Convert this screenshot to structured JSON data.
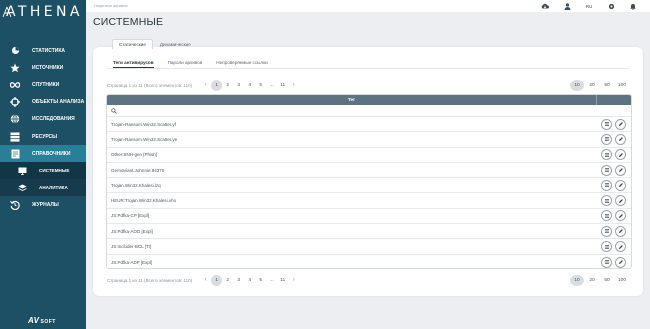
{
  "app": {
    "logo": "ATHENA",
    "brand": "SOFT"
  },
  "topbar": {
    "license": "Лицензия активна",
    "lang": "RU"
  },
  "sidebar": {
    "items": [
      {
        "label": "СТАТИСТИКА",
        "icon": "pie-chart-icon"
      },
      {
        "label": "ИСТОЧНИКИ",
        "icon": "star-icon"
      },
      {
        "label": "СПУТНИКИ",
        "icon": "infinity-icon"
      },
      {
        "label": "ОБЪЕКТЫ АНАЛИЗА",
        "icon": "crosshair-icon"
      },
      {
        "label": "ИССЛЕДОВАНИЯ",
        "icon": "globe-icon"
      },
      {
        "label": "РЕСУРСЫ",
        "icon": "database-icon"
      },
      {
        "label": "СПРАВОЧНИКИ",
        "icon": "book-icon"
      }
    ],
    "sub_items": [
      {
        "label": "СИСТЕМНЫЕ",
        "icon": "monitor-icon"
      },
      {
        "label": "АНАЛИТИКА",
        "icon": "layers-icon"
      }
    ],
    "last_item": {
      "label": "ЖУРНАЛЫ",
      "icon": "history-icon"
    }
  },
  "page": {
    "title": "СИСТЕМНЫЕ"
  },
  "outer_tabs": [
    "Статические",
    "Динамические"
  ],
  "inner_tabs": [
    "Теги антивирусов",
    "Пароли архивов",
    "Непроверяемые ссылки"
  ],
  "pager": {
    "info": "Страница 1 из 11 (Всего элементов: 110)",
    "pages": [
      "1",
      "2",
      "3",
      "4",
      "5",
      "...",
      "11"
    ],
    "sizes": [
      "10",
      "20",
      "50",
      "100"
    ]
  },
  "table": {
    "header": "Тег",
    "rows": [
      "Trojan-Ransom.Win32.Scatter.yf",
      "Trojan-Ransom.Win32.Scatter.ye",
      "Other:SNH-gen [Phish]",
      "GenVariant.Johnnie.84370",
      "Trojan.Win32.Khalesi.lzq",
      "HEUR:Trojan.Win32.Khalesi.vho",
      "JS:Pdfka-CP [Expl]",
      "JS:Pdfka-AOD [Expl]",
      "JS:Includer-BCL [Tr]",
      "JS:Pdfka-ADP [Expl]"
    ]
  }
}
